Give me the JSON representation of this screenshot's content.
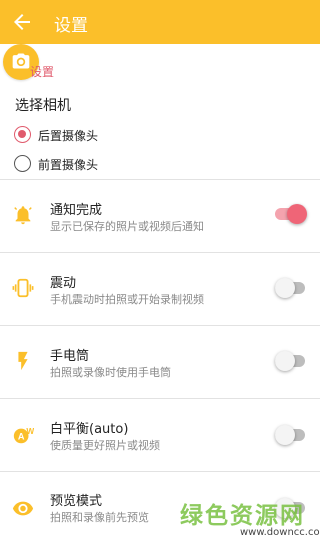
{
  "appbar": {
    "title": "设置",
    "back_icon": "back-arrow-icon",
    "color": "#fbbf2a"
  },
  "section": {
    "label": "设置",
    "icon": "camera-icon"
  },
  "camera": {
    "title": "选择相机",
    "options": [
      {
        "label": "后置摄像头",
        "selected": true
      },
      {
        "label": "前置摄像头",
        "selected": false
      }
    ]
  },
  "settings": [
    {
      "title": "通知完成",
      "desc": "显示已保存的照片或视频后通知",
      "icon": "bell-icon",
      "enabled": true
    },
    {
      "title": "震动",
      "desc": "手机震动时拍照或开始录制视频",
      "icon": "vibrate-icon",
      "enabled": false
    },
    {
      "title": "手电筒",
      "desc": "拍照或录像时使用手电筒",
      "icon": "flash-icon",
      "enabled": false
    },
    {
      "title": "白平衡(auto)",
      "desc": "使质量更好照片或视频",
      "icon": "white-balance-icon",
      "enabled": false
    },
    {
      "title": "预览模式",
      "desc": "拍照和录像前先预览",
      "icon": "eye-icon",
      "enabled": false
    }
  ],
  "watermark": {
    "text": "绿色资源网",
    "url": "www.downcc.com"
  },
  "colors": {
    "accent": "#fbbf2a",
    "pink": "#e05b6d"
  }
}
